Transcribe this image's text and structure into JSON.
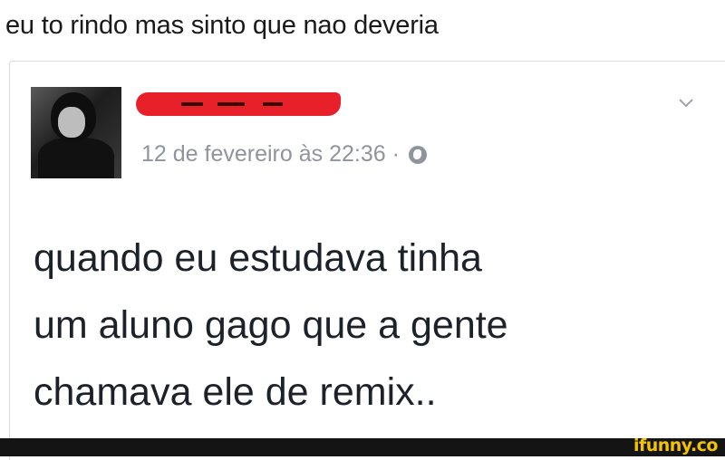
{
  "caption": "eu to rindo mas sinto que nao deveria",
  "post": {
    "author_redacted": true,
    "timestamp": "12 de fevereiro às 22:36 ·",
    "privacy_icon": "globe-icon",
    "menu_icon": "chevron-down-icon",
    "text_lines": [
      "quando eu estudava tinha",
      "um aluno gago que a gente",
      "chamava ele de remix.."
    ]
  },
  "watermark": "ifunny.co",
  "colors": {
    "redaction": "#e8202a",
    "meta_text": "#90949c",
    "post_text": "#1d2129",
    "footer_bg": "#141414",
    "brand": "#f5c400"
  }
}
